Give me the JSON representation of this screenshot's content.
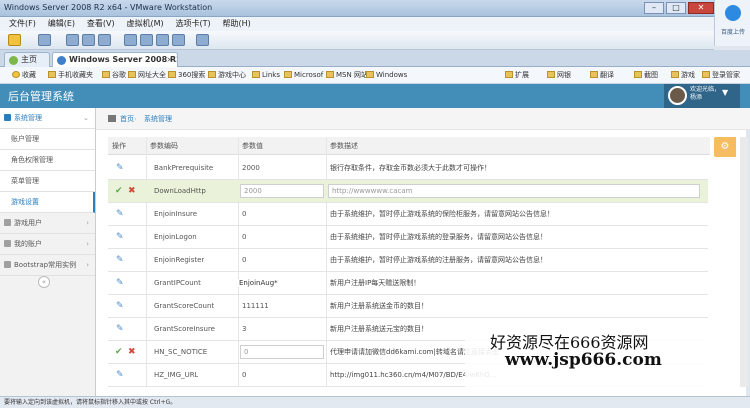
{
  "vmware": {
    "title": "Windows Server 2008 R2 x64 - VMware Workstation",
    "menu": [
      "文件(F)",
      "编辑(E)",
      "查看(V)",
      "虚拟机(M)",
      "选项卡(T)",
      "帮助(H)"
    ],
    "side_app_label": "百度上传"
  },
  "browser": {
    "tabs": [
      {
        "label": "主页"
      },
      {
        "label": "Windows Server 2008 R2 ..."
      }
    ],
    "bookmarks": [
      "收藏",
      "手机收藏夹",
      "谷歌",
      "网址大全",
      "360搜索",
      "游戏中心",
      "Links",
      "Microsof",
      "MSN 网站",
      "Windows"
    ],
    "right_tools": [
      "扩展",
      "网银",
      "翻译",
      "截图",
      "游戏",
      "登录管家"
    ]
  },
  "app": {
    "title": "后台管理系统",
    "welcome": "欢迎光临，",
    "username": "杨添"
  },
  "sidebar": {
    "system_management": "系统管理",
    "items": [
      "账户管理",
      "角色权限管理",
      "菜单管理",
      "游戏设置"
    ],
    "groups": [
      "游戏用户",
      "我的账户",
      "Bootstrap常用实例"
    ]
  },
  "breadcrumb": {
    "home": "首页",
    "current": "系统管理"
  },
  "table": {
    "headers": [
      "操作",
      "参数编码",
      "参数值",
      "参数描述"
    ],
    "rows": [
      {
        "code": "BankPrerequisite",
        "value": "2000",
        "desc": "银行存取条件，存取金币数必须大于此数才可操作！",
        "mode": "view"
      },
      {
        "code": "DownLoadHttp",
        "value": "2000",
        "desc": "http://wwwwww.cacam",
        "mode": "edit"
      },
      {
        "code": "EnjoinInsure",
        "value": "0",
        "desc": "由于系统维护，暂时停止游戏系统的保险柜服务，请留意网站公告信息！",
        "mode": "view"
      },
      {
        "code": "EnjoinLogon",
        "value": "0",
        "desc": "由于系统维护，暂时停止游戏系统的登录服务，请留意网站公告信息！",
        "mode": "view"
      },
      {
        "code": "EnjoinRegister",
        "value": "0",
        "desc": "由于系统维护，暂时停止游戏系统的注册服务，请留意网站公告信息！",
        "mode": "view"
      },
      {
        "code": "GrantIPCount",
        "value": "0",
        "desc": "新用户注册IP每天赠送限制！",
        "mode": "view"
      },
      {
        "code": "GrantScoreCount",
        "value": "111111",
        "desc": "新用户注册系统送金币的数目！",
        "mode": "view"
      },
      {
        "code": "GrantScoreInsure",
        "value": "3",
        "desc": "新用户注册系统送元宝的数目！",
        "mode": "view"
      },
      {
        "code": "HN_SC_NOTICE",
        "value": "0",
        "desc": "代理申请请加微信dd6kami.com|转域名请您直接点击",
        "mode": "edit"
      },
      {
        "code": "HZ_IMG_URL",
        "value": "0",
        "desc": "http://img011.hc360.cn/m4/M07/BD/E4/wKhQ...",
        "mode": "view"
      }
    ]
  },
  "tooltip": "EnjoinAug*",
  "status": "要将输入定向到该虚拟机，请将鼠标指针移入其中或按 Ctrl+G。",
  "watermark": {
    "line1": "好资源尽在666资源网",
    "line2": "www.jsp666.com"
  }
}
